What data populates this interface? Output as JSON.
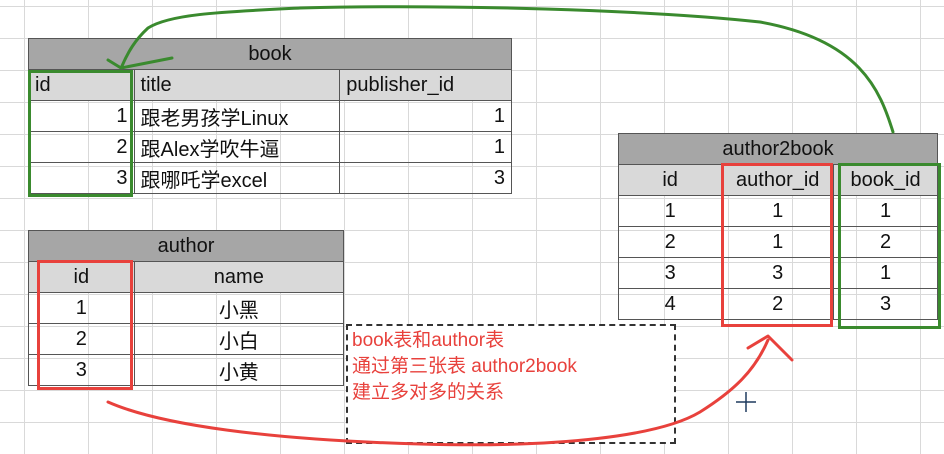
{
  "book": {
    "title": "book",
    "headers": [
      "id",
      "title",
      "publisher_id"
    ],
    "rows": [
      {
        "id": "1",
        "title": "跟老男孩学Linux",
        "publisher_id": "1"
      },
      {
        "id": "2",
        "title": "跟Alex学吹牛逼",
        "publisher_id": "1"
      },
      {
        "id": "3",
        "title": "跟哪吒学excel",
        "publisher_id": "3"
      }
    ]
  },
  "author": {
    "title": "author",
    "headers": [
      "id",
      "name"
    ],
    "rows": [
      {
        "id": "1",
        "name": "小黑"
      },
      {
        "id": "2",
        "name": "小白"
      },
      {
        "id": "3",
        "name": "小黄"
      }
    ]
  },
  "author2book": {
    "title": "author2book",
    "headers": [
      "id",
      "author_id",
      "book_id"
    ],
    "rows": [
      {
        "id": "1",
        "author_id": "1",
        "book_id": "1"
      },
      {
        "id": "2",
        "author_id": "1",
        "book_id": "2"
      },
      {
        "id": "3",
        "author_id": "3",
        "book_id": "1"
      },
      {
        "id": "4",
        "author_id": "2",
        "book_id": "3"
      }
    ]
  },
  "note": {
    "line1": "book表和author表",
    "line2": "通过第三张表  author2book",
    "line3": "建立多对多的关系"
  },
  "colors": {
    "green_annotation": "#3a8a2e",
    "red_annotation": "#e8413c",
    "title_fill": "#a6a6a6",
    "header_fill": "#d9d9d9"
  }
}
